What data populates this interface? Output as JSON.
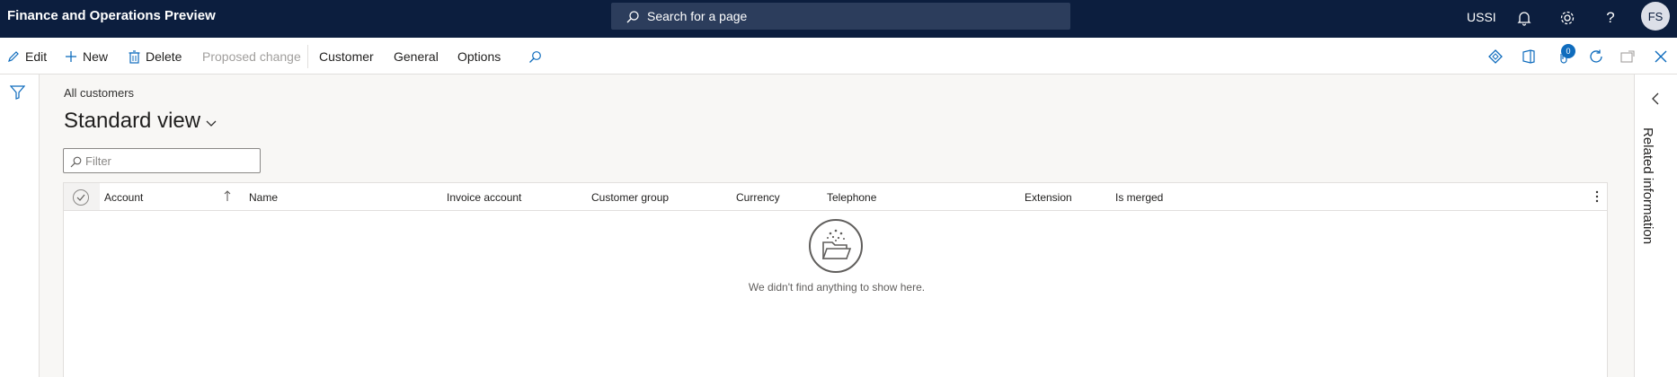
{
  "header": {
    "app_title": "Finance and Operations Preview",
    "search_placeholder": "Search for a page",
    "company": "USSI",
    "avatar_initials": "FS",
    "icons": [
      "search-icon",
      "bell-icon",
      "gear-icon",
      "help-icon"
    ]
  },
  "toolbar": {
    "edit_label": "Edit",
    "new_label": "New",
    "delete_label": "Delete",
    "proposed_change_label": "Proposed change",
    "customer_tab": "Customer",
    "general_tab": "General",
    "options_tab": "Options",
    "attachments_count": "0",
    "right_icons": [
      "diamond-icon",
      "office-icon",
      "attachment-icon",
      "refresh-icon",
      "open-new-window-icon",
      "close-icon"
    ]
  },
  "page": {
    "breadcrumb": "All customers",
    "view_name": "Standard view",
    "filter_placeholder": "Filter"
  },
  "grid": {
    "columns": [
      "Account",
      "Name",
      "Invoice account",
      "Customer group",
      "Currency",
      "Telephone",
      "Extension",
      "Is merged"
    ],
    "sorted_column": "Account",
    "sort_direction": "ascending",
    "rows": [],
    "empty_message": "We didn't find anything to show here."
  },
  "right_pane": {
    "label": "Related information"
  },
  "colors": {
    "nav_background": "#0c1e3e",
    "search_background": "#2c3d5c",
    "accent": "#0f6cbd",
    "page_background": "#f8f7f5"
  }
}
